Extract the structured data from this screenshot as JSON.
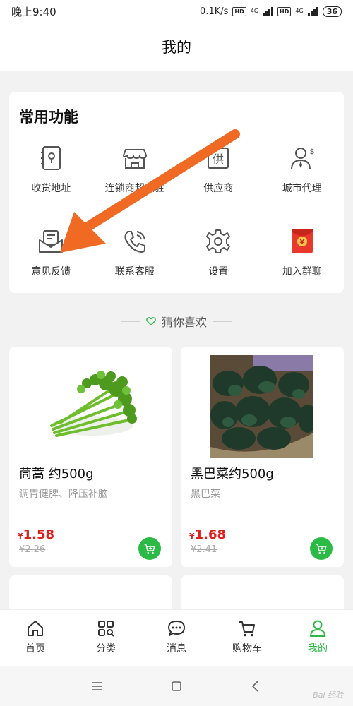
{
  "status": {
    "time": "晚上9:40",
    "speed": "0.1K/s",
    "hd1": "HD",
    "net1": "4G",
    "hd2": "HD",
    "net2": "4G",
    "battery": "36"
  },
  "header": {
    "title": "我的"
  },
  "functions": {
    "title": "常用功能",
    "items": [
      {
        "label": "收货地址",
        "icon": "address-book-icon"
      },
      {
        "label": "连锁商超入驻",
        "icon": "store-icon"
      },
      {
        "label": "供应商",
        "icon": "supplier-icon"
      },
      {
        "label": "城市代理",
        "icon": "agent-icon"
      },
      {
        "label": "意见反馈",
        "icon": "feedback-icon"
      },
      {
        "label": "联系客服",
        "icon": "phone-icon"
      },
      {
        "label": "设置",
        "icon": "gear-icon"
      },
      {
        "label": "加入群聊",
        "icon": "red-envelope-icon"
      }
    ],
    "supplier_glyph": "供",
    "envelope_glyph": "¥"
  },
  "guess": {
    "title": "猜你喜欢"
  },
  "products": [
    {
      "name": "茼蒿 约500g",
      "desc": "调胃健脾、降压补脑",
      "currency": "¥",
      "price": "1.58",
      "original": "¥2.26"
    },
    {
      "name": "黑巴菜约500g",
      "desc": "黑巴菜",
      "currency": "¥",
      "price": "1.68",
      "original": "¥2.41"
    }
  ],
  "tabbar": [
    {
      "label": "首页",
      "icon": "home-icon"
    },
    {
      "label": "分类",
      "icon": "category-icon"
    },
    {
      "label": "消息",
      "icon": "message-icon"
    },
    {
      "label": "购物车",
      "icon": "cart-icon"
    },
    {
      "label": "我的",
      "icon": "user-icon",
      "active": true
    }
  ],
  "watermark": "Bai 经验",
  "colors": {
    "accent": "#2cba46",
    "price": "#e01e1e",
    "arrow": "#f06a23"
  }
}
